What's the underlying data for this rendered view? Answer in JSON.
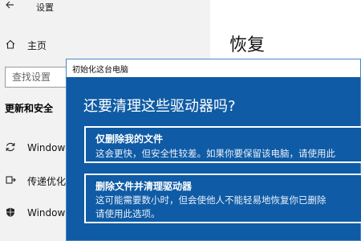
{
  "settings": {
    "window_title": "设置",
    "back_icon": "arrow-left-icon",
    "home_label": "主页",
    "search_placeholder": "查找设置",
    "section_title": "更新和安全",
    "nav_items": [
      {
        "label": "Windows",
        "icon": "refresh-icon"
      },
      {
        "label": "传递优化",
        "icon": "delivery-optimization-icon"
      },
      {
        "label": "Windows",
        "icon": "shield-icon"
      }
    ],
    "page_title": "恢复"
  },
  "dialog": {
    "title": "初始化这台电脑",
    "heading": "还要清理这些驱动器吗?",
    "options": [
      {
        "title": "仅删除我的文件",
        "description_lines": [
          "这会更快，但安全性较差。如果你要保留该电脑，请使用此"
        ]
      },
      {
        "title": "删除文件并清理驱动器",
        "description_lines": [
          "这可能需要数小时，但会使他人不能轻易地恢复你已删除",
          "请使用此选项。"
        ]
      }
    ],
    "background_color": "#0f5ba5",
    "border_color": "#ffffff"
  }
}
